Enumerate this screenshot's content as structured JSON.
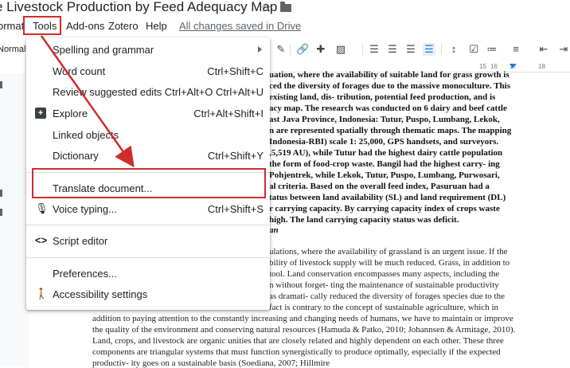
{
  "title": {
    "doc_title": "e Livestock Production by Feed Adequacy Map"
  },
  "menubar": {
    "format_label": "ormat",
    "tools_label": "Tools",
    "addons_label": "Add-ons",
    "zotero_label": "Zotero",
    "help_label": "Help",
    "saved_status": "All changes saved in Drive"
  },
  "toolbar": {
    "style_value": "Normal"
  },
  "ruler": {
    "label_left": "15",
    "label_mid": "16",
    "label_right": "17",
    "label_18": "18"
  },
  "tools_menu": {
    "items": [
      {
        "label": "Spelling and grammar",
        "shortcut": ""
      },
      {
        "label": "Word count",
        "shortcut": "Ctrl+Shift+C"
      },
      {
        "label": "Review suggested edits",
        "shortcut": "Ctrl+Alt+O Ctrl+Alt+U"
      },
      {
        "label": "Explore",
        "shortcut": "Ctrl+Alt+Shift+I"
      },
      {
        "label": "Linked objects",
        "shortcut": ""
      },
      {
        "label": "Dictionary",
        "shortcut": "Ctrl+Shift+Y"
      },
      {
        "label": "Translate document...",
        "shortcut": ""
      },
      {
        "label": "Voice typing...",
        "shortcut": "Ctrl+Shift+S"
      },
      {
        "label": "Script editor",
        "shortcut": ""
      },
      {
        "label": "Preferences...",
        "shortcut": ""
      },
      {
        "label": "Accessibility settings",
        "shortcut": ""
      }
    ]
  },
  "document": {
    "bold_lines": [
      "uation, where the availability of suitable land for grass growth is",
      "ced the diversity of forages due to the massive monoculture. This",
      " existing land, dis- tribution, potential feed production, and is",
      "acy map. The research was conducted on 6 dairy and beef cattle",
      "ast Java Province, Indonesia: Tutur, Puspo, Lumbang, Lekok,",
      "n are represented spatially through thematic maps. The mapping",
      "Indonesia-RBI) scale 1: 25,000, GPS handsets, and surveyors.",
      ",5,519 AU), while Tutur had the highest dairy cattle population",
      " the form of food-crop waste. Bangil had the highest carry- ing",
      " Pohjentrek, while Lekok, Tutur, Puspo, Lumbang, Purwosari,",
      "al criteria. Based on the overall feed index, Pasuruan had a",
      "tatus between land availability (SL) and land requirement (DL)",
      "r carrying capacity. By carrying capacity index of crops waste",
      "high. The land carrying capacity status was deficit.",
      "an"
    ],
    "body_lines": [
      "ulations, where the availability of grassland is an urgent issue. If the",
      "bility of livestock supply will be much reduced. Grass, in addition to",
      "tool. Land conservation encompasses many aspects, including the",
      "n without forget- ting the maintenance of sustainable productivity",
      "as dramati- cally reduced the diversity of forages species due to the",
      "fact is contrary to the concept of sustainable agriculture, which in"
    ],
    "full_lines": [
      "addition to paying attention to the constantly increasing and changing needs of humans, we have to maintain or improve",
      "the quality of the environment and conserving natural resources (Hamuda & Patko, 2010; Johannsen & Armitage, 2010).",
      "Land, crops, and livestock are organic unities that are closely related and highly dependent on each other. These three",
      "components are triangular systems that must function synergistically to produce optimally, especially if the expected",
      "productiv- ity goes on a sustainable basis (Soediana, 2007; Hillmire"
    ]
  },
  "colors": {
    "annotation_red": "#d12c2c",
    "accent_blue": "#1a73e8"
  }
}
